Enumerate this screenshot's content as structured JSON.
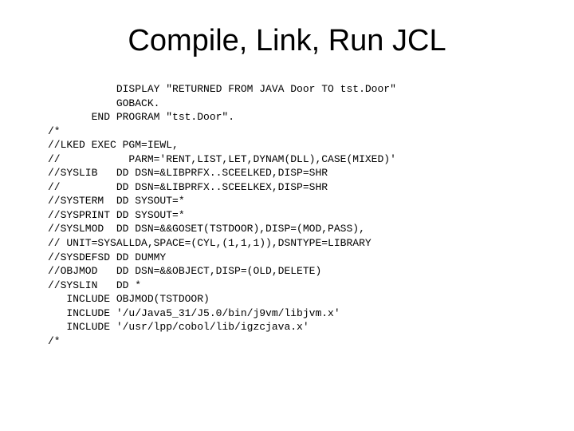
{
  "title": "Compile, Link, Run JCL",
  "code_lines": [
    "           DISPLAY \"RETURNED FROM JAVA Door TO tst.Door\"",
    "           GOBACK.",
    "       END PROGRAM \"tst.Door\".",
    "/*",
    "//LKED EXEC PGM=IEWL,",
    "//           PARM='RENT,LIST,LET,DYNAM(DLL),CASE(MIXED)'",
    "//SYSLIB   DD DSN=&LIBPRFX..SCEELKED,DISP=SHR",
    "//         DD DSN=&LIBPRFX..SCEELKEX,DISP=SHR",
    "//SYSTERM  DD SYSOUT=*",
    "//SYSPRINT DD SYSOUT=*",
    "//SYSLMOD  DD DSN=&&GOSET(TSTDOOR),DISP=(MOD,PASS),",
    "// UNIT=SYSALLDA,SPACE=(CYL,(1,1,1)),DSNTYPE=LIBRARY",
    "//SYSDEFSD DD DUMMY",
    "//OBJMOD   DD DSN=&&OBJECT,DISP=(OLD,DELETE)",
    "//SYSLIN   DD *",
    "   INCLUDE OBJMOD(TSTDOOR)",
    "   INCLUDE '/u/Java5_31/J5.0/bin/j9vm/libjvm.x'",
    "   INCLUDE '/usr/lpp/cobol/lib/igzcjava.x'",
    "/*"
  ]
}
